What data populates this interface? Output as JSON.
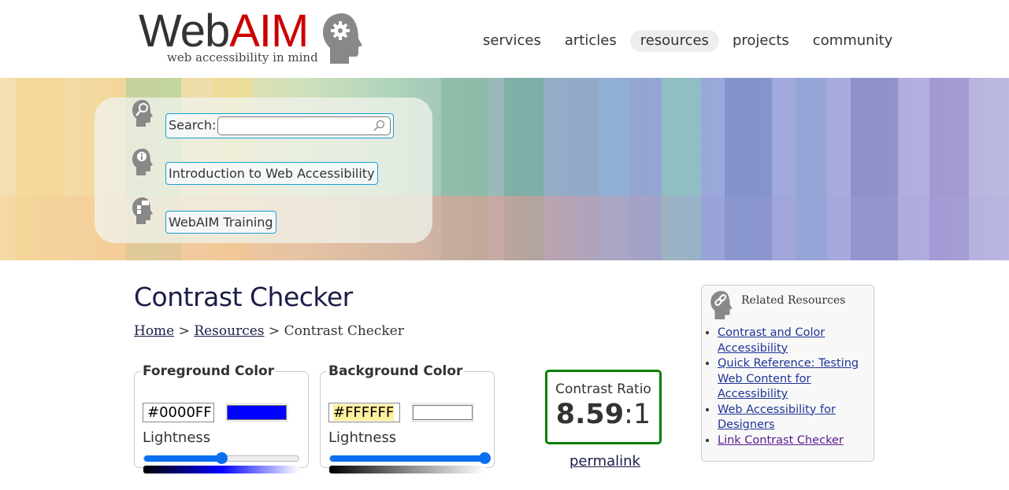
{
  "logo": {
    "name_part1": "Web",
    "name_part2": "AIM",
    "tagline": "web accessibility in mind"
  },
  "nav": {
    "items": [
      {
        "label": "services"
      },
      {
        "label": "articles"
      },
      {
        "label": "resources",
        "active": true
      },
      {
        "label": "projects"
      },
      {
        "label": "community"
      }
    ]
  },
  "quick_links": {
    "search_label": "Search:",
    "search_value": "",
    "intro": "Introduction to Web Accessibility",
    "training": "WebAIM Training"
  },
  "page": {
    "title": "Contrast Checker",
    "breadcrumb": [
      {
        "label": "Home"
      },
      {
        "label": "Resources"
      },
      {
        "label": "Contrast Checker"
      }
    ],
    "separator": ">"
  },
  "foreground": {
    "legend": "Foreground Color",
    "hex": "#0000FF",
    "color": "#0000FF",
    "lightness_label": "Lightness",
    "lightness": 0.5
  },
  "background": {
    "legend": "Background Color",
    "hex": "#FFFFFF",
    "color": "#FFFFFF",
    "lightness_label": "Lightness",
    "lightness": 1.0
  },
  "result": {
    "label": "Contrast Ratio",
    "ratio": "8.59",
    "suffix": ":1",
    "border_color": "#008000",
    "permalink": "permalink"
  },
  "related": {
    "title": "Related Resources",
    "links": [
      {
        "label": "Contrast and Color Accessibility"
      },
      {
        "label": "Quick Reference: Testing Web Content for Accessibility"
      },
      {
        "label": "Web Accessibility for Designers"
      },
      {
        "label": "Link Contrast Checker",
        "visited": true
      }
    ]
  }
}
